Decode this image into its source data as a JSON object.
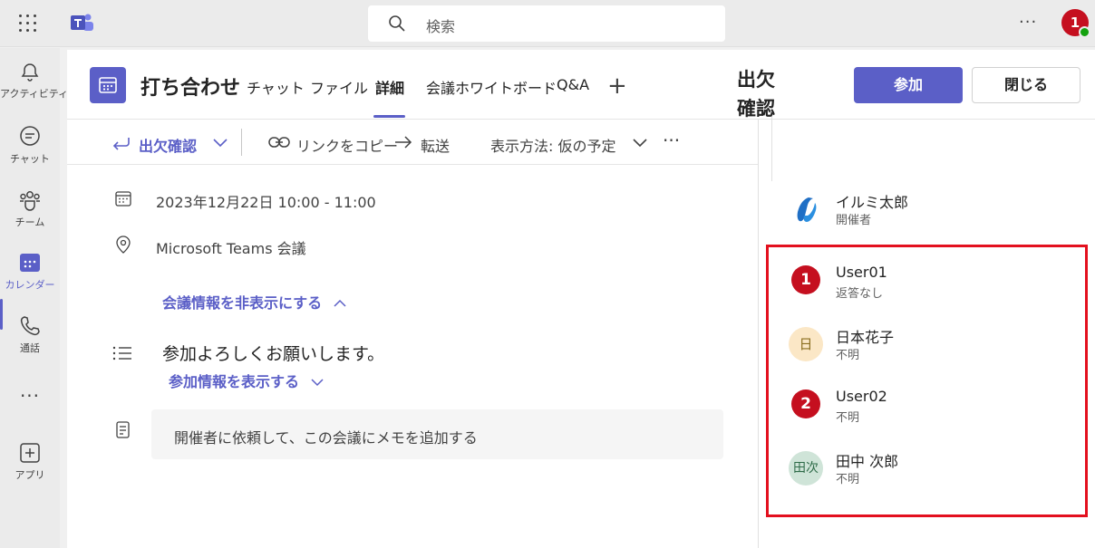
{
  "search": {
    "placeholder": "検索"
  },
  "top_avatar_badge": "1",
  "rail": [
    {
      "label": "アクティビティ",
      "icon": "bell-icon"
    },
    {
      "label": "チャット",
      "icon": "chat-icon"
    },
    {
      "label": "チーム",
      "icon": "teams-icon"
    },
    {
      "label": "カレンダー",
      "icon": "calendar-icon",
      "active": true
    },
    {
      "label": "通話",
      "icon": "phone-icon"
    },
    {
      "label": "アプリ",
      "icon": "plus-box-icon"
    }
  ],
  "meeting": {
    "title": "打ち合わせ",
    "tabs": [
      "チャット",
      "ファイル",
      "詳細",
      "会議ホワイトボード",
      "Q&A"
    ],
    "active_tab": "詳細",
    "join_label": "参加",
    "close_label": "閉じる"
  },
  "toolbar": {
    "rsvp_label": "出欠確認",
    "copy_link_label": "リンクをコピー",
    "forward_label": "転送",
    "show_as_label": "表示方法: 仮の予定"
  },
  "details": {
    "datetime": "2023年12月22日 10:00 - 11:00",
    "location": "Microsoft Teams 会議",
    "hide_info_link": "会議情報を非表示にする",
    "agenda": "参加よろしくお願いします。",
    "show_join_info_link": "参加情報を表示する",
    "notes_prompt": "開催者に依頼して、この会議にメモを追加する"
  },
  "attendance": {
    "title_line1": "出欠",
    "title_line2": "確認",
    "organizer": {
      "name": "イルミ太郎",
      "role": "開催者"
    },
    "attendees": [
      {
        "badge": "1",
        "name": "User01",
        "status": "返答なし"
      },
      {
        "initials": "日",
        "name": "日本花子",
        "status": "不明",
        "color": "#fbe7c6"
      },
      {
        "badge": "2",
        "name": "User02",
        "status": "不明"
      },
      {
        "initials": "田次",
        "name": "田中 次郎",
        "status": "不明",
        "color": "#cfe4d8"
      }
    ]
  },
  "colors": {
    "accent": "#5b5fc7",
    "highlight": "#e3101e",
    "badge": "#c50f1f"
  }
}
